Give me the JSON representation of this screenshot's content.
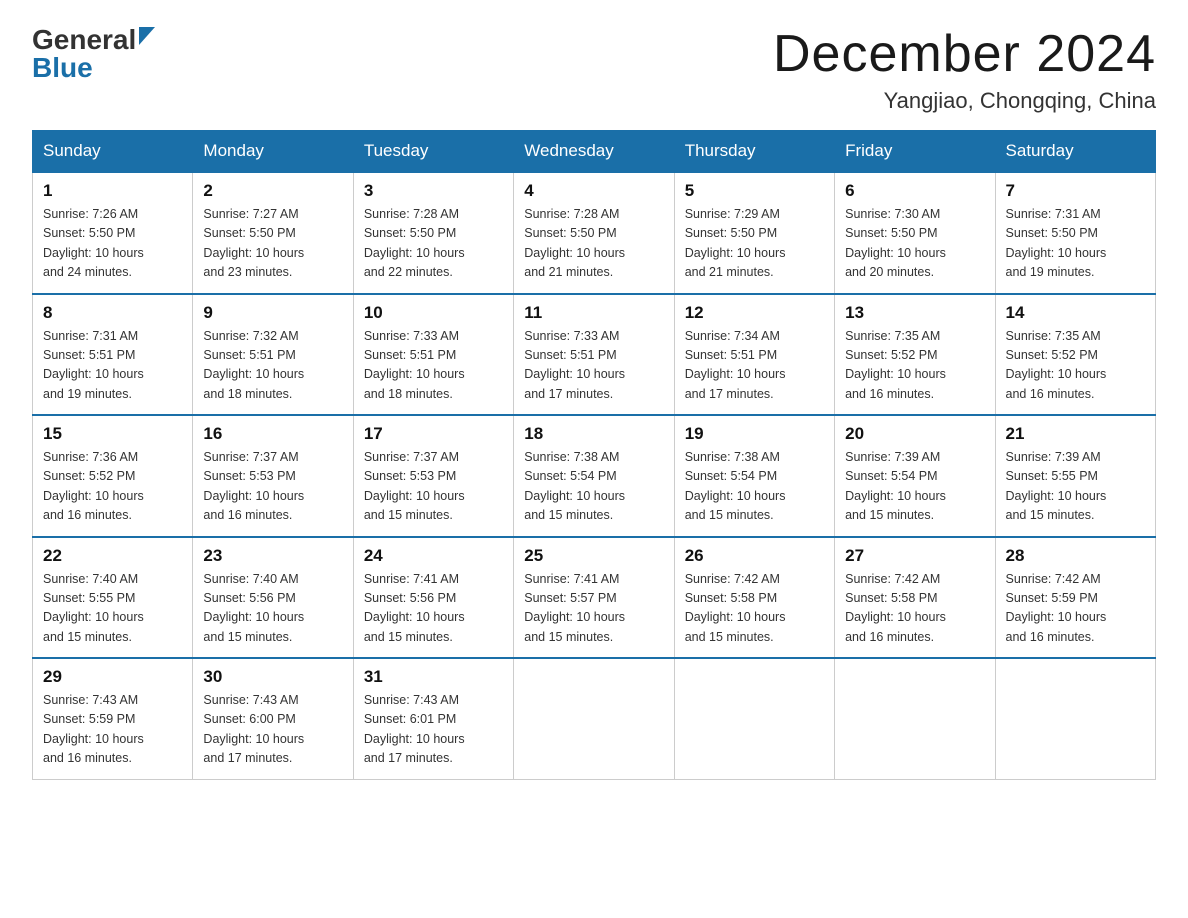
{
  "logo": {
    "general": "General",
    "blue": "Blue"
  },
  "title": "December 2024",
  "subtitle": "Yangjiao, Chongqing, China",
  "days_of_week": [
    "Sunday",
    "Monday",
    "Tuesday",
    "Wednesday",
    "Thursday",
    "Friday",
    "Saturday"
  ],
  "weeks": [
    [
      {
        "day": "1",
        "sunrise": "7:26 AM",
        "sunset": "5:50 PM",
        "daylight": "10 hours and 24 minutes."
      },
      {
        "day": "2",
        "sunrise": "7:27 AM",
        "sunset": "5:50 PM",
        "daylight": "10 hours and 23 minutes."
      },
      {
        "day": "3",
        "sunrise": "7:28 AM",
        "sunset": "5:50 PM",
        "daylight": "10 hours and 22 minutes."
      },
      {
        "day": "4",
        "sunrise": "7:28 AM",
        "sunset": "5:50 PM",
        "daylight": "10 hours and 21 minutes."
      },
      {
        "day": "5",
        "sunrise": "7:29 AM",
        "sunset": "5:50 PM",
        "daylight": "10 hours and 21 minutes."
      },
      {
        "day": "6",
        "sunrise": "7:30 AM",
        "sunset": "5:50 PM",
        "daylight": "10 hours and 20 minutes."
      },
      {
        "day": "7",
        "sunrise": "7:31 AM",
        "sunset": "5:50 PM",
        "daylight": "10 hours and 19 minutes."
      }
    ],
    [
      {
        "day": "8",
        "sunrise": "7:31 AM",
        "sunset": "5:51 PM",
        "daylight": "10 hours and 19 minutes."
      },
      {
        "day": "9",
        "sunrise": "7:32 AM",
        "sunset": "5:51 PM",
        "daylight": "10 hours and 18 minutes."
      },
      {
        "day": "10",
        "sunrise": "7:33 AM",
        "sunset": "5:51 PM",
        "daylight": "10 hours and 18 minutes."
      },
      {
        "day": "11",
        "sunrise": "7:33 AM",
        "sunset": "5:51 PM",
        "daylight": "10 hours and 17 minutes."
      },
      {
        "day": "12",
        "sunrise": "7:34 AM",
        "sunset": "5:51 PM",
        "daylight": "10 hours and 17 minutes."
      },
      {
        "day": "13",
        "sunrise": "7:35 AM",
        "sunset": "5:52 PM",
        "daylight": "10 hours and 16 minutes."
      },
      {
        "day": "14",
        "sunrise": "7:35 AM",
        "sunset": "5:52 PM",
        "daylight": "10 hours and 16 minutes."
      }
    ],
    [
      {
        "day": "15",
        "sunrise": "7:36 AM",
        "sunset": "5:52 PM",
        "daylight": "10 hours and 16 minutes."
      },
      {
        "day": "16",
        "sunrise": "7:37 AM",
        "sunset": "5:53 PM",
        "daylight": "10 hours and 16 minutes."
      },
      {
        "day": "17",
        "sunrise": "7:37 AM",
        "sunset": "5:53 PM",
        "daylight": "10 hours and 15 minutes."
      },
      {
        "day": "18",
        "sunrise": "7:38 AM",
        "sunset": "5:54 PM",
        "daylight": "10 hours and 15 minutes."
      },
      {
        "day": "19",
        "sunrise": "7:38 AM",
        "sunset": "5:54 PM",
        "daylight": "10 hours and 15 minutes."
      },
      {
        "day": "20",
        "sunrise": "7:39 AM",
        "sunset": "5:54 PM",
        "daylight": "10 hours and 15 minutes."
      },
      {
        "day": "21",
        "sunrise": "7:39 AM",
        "sunset": "5:55 PM",
        "daylight": "10 hours and 15 minutes."
      }
    ],
    [
      {
        "day": "22",
        "sunrise": "7:40 AM",
        "sunset": "5:55 PM",
        "daylight": "10 hours and 15 minutes."
      },
      {
        "day": "23",
        "sunrise": "7:40 AM",
        "sunset": "5:56 PM",
        "daylight": "10 hours and 15 minutes."
      },
      {
        "day": "24",
        "sunrise": "7:41 AM",
        "sunset": "5:56 PM",
        "daylight": "10 hours and 15 minutes."
      },
      {
        "day": "25",
        "sunrise": "7:41 AM",
        "sunset": "5:57 PM",
        "daylight": "10 hours and 15 minutes."
      },
      {
        "day": "26",
        "sunrise": "7:42 AM",
        "sunset": "5:58 PM",
        "daylight": "10 hours and 15 minutes."
      },
      {
        "day": "27",
        "sunrise": "7:42 AM",
        "sunset": "5:58 PM",
        "daylight": "10 hours and 16 minutes."
      },
      {
        "day": "28",
        "sunrise": "7:42 AM",
        "sunset": "5:59 PM",
        "daylight": "10 hours and 16 minutes."
      }
    ],
    [
      {
        "day": "29",
        "sunrise": "7:43 AM",
        "sunset": "5:59 PM",
        "daylight": "10 hours and 16 minutes."
      },
      {
        "day": "30",
        "sunrise": "7:43 AM",
        "sunset": "6:00 PM",
        "daylight": "10 hours and 17 minutes."
      },
      {
        "day": "31",
        "sunrise": "7:43 AM",
        "sunset": "6:01 PM",
        "daylight": "10 hours and 17 minutes."
      },
      null,
      null,
      null,
      null
    ]
  ],
  "labels": {
    "sunrise": "Sunrise:",
    "sunset": "Sunset:",
    "daylight": "Daylight:"
  }
}
